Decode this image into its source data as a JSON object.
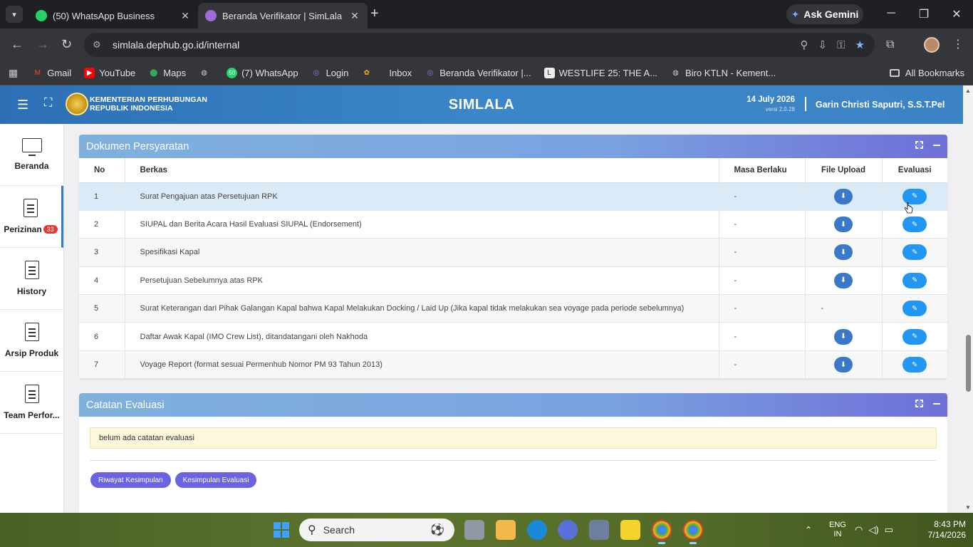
{
  "browser": {
    "tabs": [
      {
        "title": "(50) WhatsApp Business",
        "favicon_color": "#25d366",
        "favicon_text": "50"
      },
      {
        "title": "Beranda Verifikator | SimLala",
        "favicon_color": "#a06cd5",
        "favicon_text": ""
      }
    ],
    "new_tab": "+",
    "ask_gemini": "Ask Gemini",
    "url": "simlala.dephub.go.id/internal",
    "bookmarks": [
      {
        "label": "Gmail",
        "color": "#ea4335",
        "glyph": "M"
      },
      {
        "label": "YouTube",
        "color": "#ff0000",
        "glyph": "▶"
      },
      {
        "label": "Maps",
        "color": "#34a853",
        "glyph": "⬤"
      },
      {
        "label": "",
        "color": "#666",
        "glyph": "◍"
      },
      {
        "label": "(7) WhatsApp",
        "color": "#25d366",
        "glyph": "50"
      },
      {
        "label": "Login",
        "color": "#a06cd5",
        "glyph": "◎"
      },
      {
        "label": "",
        "color": "#f4b400",
        "glyph": "✿"
      },
      {
        "label": "Inbox",
        "color": "#666",
        "glyph": "✉"
      },
      {
        "label": "Beranda Verifikator |...",
        "color": "#a06cd5",
        "glyph": "◎"
      },
      {
        "label": "WESTLIFE 25: THE A...",
        "color": "#eee",
        "glyph": "L"
      },
      {
        "label": "Biro KTLN - Kement...",
        "color": "#666",
        "glyph": "◍"
      }
    ],
    "all_bookmarks": "All Bookmarks"
  },
  "header": {
    "org_line1": "KEMENTERIAN PERHUBUNGAN",
    "org_line2": "REPUBLIK INDONESIA",
    "app_title": "SIMLALA",
    "date": "14 July 2026",
    "version": "versi 2.0.28",
    "user": "Garin Christi Saputri, S.S.T.Pel"
  },
  "sidebar": {
    "items": [
      {
        "label": "Beranda",
        "icon": "monitor-icon"
      },
      {
        "label": "Perizinan",
        "badge": "33",
        "icon": "document-icon"
      },
      {
        "label": "History",
        "icon": "document-icon"
      },
      {
        "label": "Arsip Produk",
        "icon": "document-icon"
      },
      {
        "label": "Team Perfor...",
        "icon": "document-icon"
      }
    ]
  },
  "dokumen": {
    "title": "Dokumen Persyaratan",
    "columns": {
      "no": "No",
      "berkas": "Berkas",
      "masa": "Masa Berlaku",
      "file": "File Upload",
      "eval": "Evaluasi"
    },
    "rows": [
      {
        "no": "1",
        "berkas": "Surat Pengajuan atas Persetujuan RPK",
        "masa": "-",
        "file": "download",
        "highlight": true
      },
      {
        "no": "2",
        "berkas": "SIUPAL dan Berita Acara Hasil Evaluasi SIUPAL (Endorsement)",
        "masa": "-",
        "file": "download"
      },
      {
        "no": "3",
        "berkas": "Spesifikasi Kapal",
        "masa": "-",
        "file": "download"
      },
      {
        "no": "4",
        "berkas": "Persetujuan Sebelumnya atas RPK",
        "masa": "-",
        "file": "download"
      },
      {
        "no": "5",
        "berkas": "Surat Keterangan dari Pihak Galangan Kapal bahwa Kapal Melakukan Docking / Laid Up (Jika kapal tidak melakukan sea voyage pada periode sebelumnya)",
        "masa": "-",
        "file": "-"
      },
      {
        "no": "6",
        "berkas": "Daftar Awak Kapal (IMO Crew List), ditandatangani oleh Nakhoda",
        "masa": "-",
        "file": "download"
      },
      {
        "no": "7",
        "berkas": "Voyage Report (format sesuai Permenhub Nomor PM 93 Tahun 2013)",
        "masa": "-",
        "file": "download"
      }
    ]
  },
  "catatan": {
    "title": "Catatan Evaluasi",
    "note": "belum ada catatan evaluasi",
    "btn_riwayat": "Riwayat Kesimpulan",
    "btn_kesimpulan": "Kesimpulan Evaluasi"
  },
  "taskbar": {
    "search_placeholder": "Search",
    "lang_1": "ENG",
    "lang_2": "IN",
    "time": "8:43 PM",
    "date": "7/14/2026"
  }
}
